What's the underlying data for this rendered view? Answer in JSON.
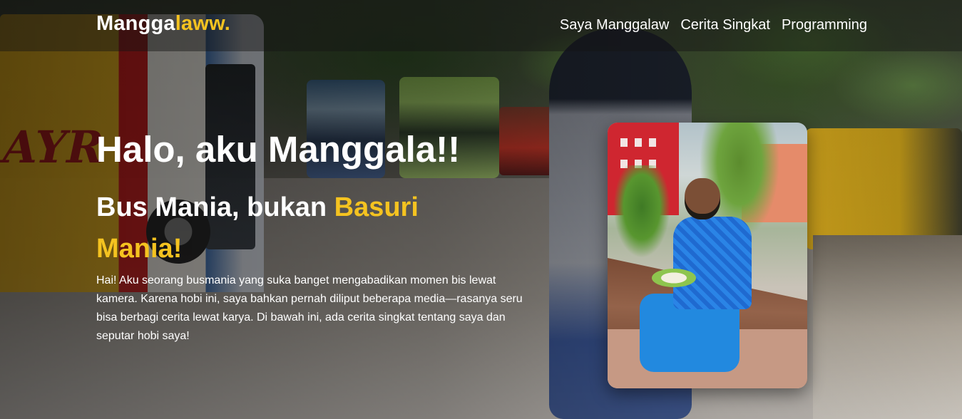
{
  "nav": {
    "brand_main": "Mangga",
    "brand_accent": "laww.",
    "links": [
      {
        "label": "Saya Manggalaw"
      },
      {
        "label": "Cerita Singkat"
      },
      {
        "label": "Programming"
      }
    ]
  },
  "hero": {
    "title": "Halo, aku Manggala!!",
    "subtitle_main": "Bus Mania, bukan ",
    "subtitle_accent": "Basuri Mania!",
    "description": "Hai! Aku seorang busmania yang suka banget mengabadikan momen bis lewat kamera. Karena hobi ini, saya bahkan pernah diliput beberapa media—rasanya seru bisa berbagi cerita lewat karya. Di bawah ini, ada cerita singkat tentang saya dan seputar hobi saya!"
  },
  "colors": {
    "accent": "#f5c320",
    "text": "#ffffff",
    "navbar_bg": "rgba(20,20,20,0.45)"
  }
}
